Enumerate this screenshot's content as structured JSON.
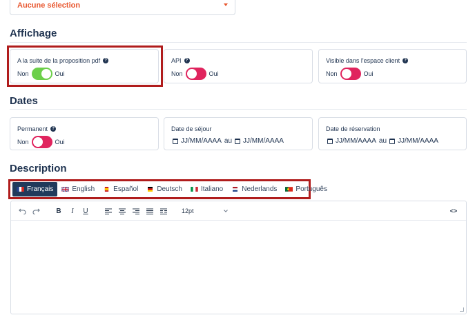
{
  "top_select": {
    "value": "Aucune sélection",
    "ghost": "Aucune sélection"
  },
  "affichage": {
    "title": "Affichage",
    "cards": [
      {
        "label": "A la suite de la proposition pdf",
        "off": "Non",
        "on": "Oui",
        "state": "on"
      },
      {
        "label": "API",
        "off": "Non",
        "on": "Oui",
        "state": "off"
      },
      {
        "label": "Visible dans l'espace client",
        "off": "Non",
        "on": "Oui",
        "state": "off"
      }
    ]
  },
  "dates": {
    "title": "Dates",
    "permanent": {
      "label": "Permanent",
      "off": "Non",
      "on": "Oui",
      "state": "off"
    },
    "sejour": {
      "label": "Date de séjour",
      "from": "JJ/MM/AAAA",
      "sep": "au",
      "to": "JJ/MM/AAAA"
    },
    "reservation": {
      "label": "Date de réservation",
      "from": "JJ/MM/AAAA",
      "sep": "au",
      "to": "JJ/MM/AAAA"
    }
  },
  "description": {
    "title": "Description",
    "languages": [
      {
        "label": "Français",
        "flag": "fr",
        "active": true
      },
      {
        "label": "English",
        "flag": "gb",
        "active": false
      },
      {
        "label": "Español",
        "flag": "es",
        "active": false
      },
      {
        "label": "Deutsch",
        "flag": "de",
        "active": false
      },
      {
        "label": "Italiano",
        "flag": "it",
        "active": false
      },
      {
        "label": "Nederlands",
        "flag": "nl",
        "active": false
      },
      {
        "label": "Português",
        "flag": "pt",
        "active": false
      }
    ],
    "toolbar": {
      "bold": "B",
      "italic": "I",
      "underline": "U",
      "font_size": "12pt",
      "code": "<>"
    }
  },
  "colors": {
    "accent_orange": "#e8562e",
    "toggle_on": "#6ccf4a",
    "toggle_off": "#e0245e",
    "navy": "#213a5b",
    "highlight": "#b01c1c"
  }
}
